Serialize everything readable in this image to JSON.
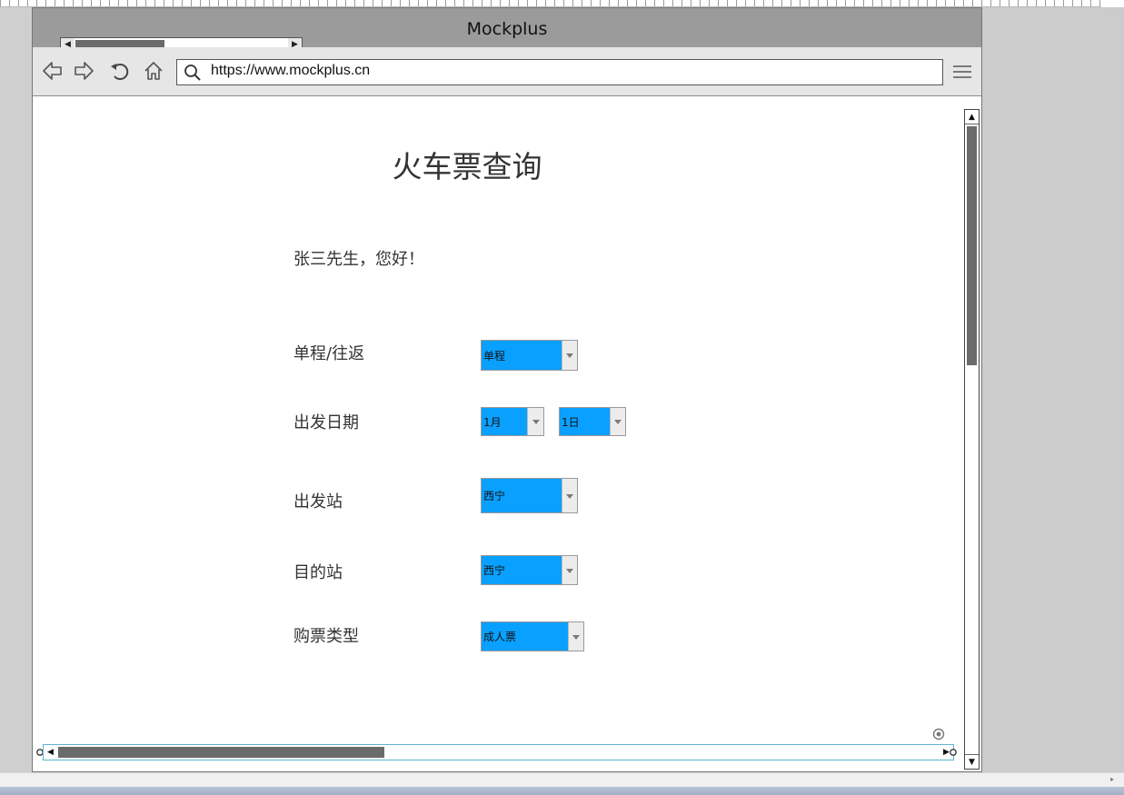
{
  "window": {
    "title": "Mockplus"
  },
  "address_bar": {
    "url": "https://www.mockplus.cn"
  },
  "page": {
    "title": "火车票查询",
    "greeting": "张三先生，您好！"
  },
  "form": {
    "trip_type": {
      "label": "单程/往返",
      "value": "单程"
    },
    "departure_date": {
      "label": "出发日期",
      "month": "1月",
      "day": "1日"
    },
    "departure_station": {
      "label": "出发站",
      "value": "西宁"
    },
    "destination_station": {
      "label": "目的站",
      "value": "西宁"
    },
    "ticket_type": {
      "label": "购票类型",
      "value": "成人票"
    }
  },
  "colors": {
    "dropdown_fill": "#0aa0ff",
    "title_bar": "#9b9b9b",
    "toolbar": "#e6e6e6"
  },
  "icons": [
    "back-icon",
    "forward-icon",
    "refresh-icon",
    "home-icon",
    "search-icon",
    "menu-icon",
    "gear-icon"
  ]
}
